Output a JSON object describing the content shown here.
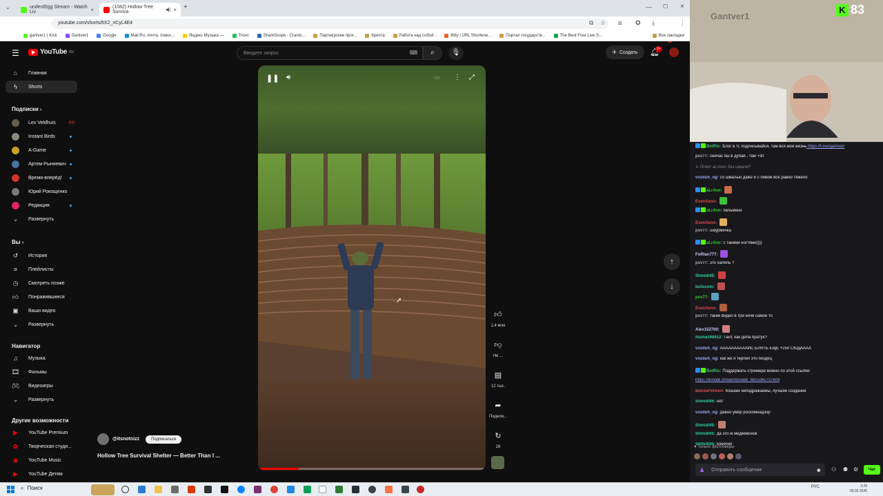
{
  "browser": {
    "tabs": [
      {
        "title": "underd0gg Stream - Watch Liv",
        "color": "#53fc18",
        "active": false
      },
      {
        "title": "(1082) Hollow Tree Surviva",
        "color": "#ff0000",
        "active": true
      }
    ],
    "url": "youtube.com/shorts/6X2_nCyL4E4",
    "bookmarks": [
      "gantver1 | Kick",
      "Gantver1",
      "Google",
      "Mail.Ru: почта, поиск...",
      "Яндекс Музыка —",
      "Trovo",
      "SharkScope - Cranio...",
      "Партнерские прог...",
      "Крипта",
      "Работа над собой -",
      "Bitly | URL Shortene...",
      "Портал государств...",
      "The Best Free Live S...",
      "Все закладки"
    ]
  },
  "youtube": {
    "logo_text": "YouTube",
    "logo_region": "RU",
    "search_placeholder": "Введите запрос",
    "create_label": "Создать",
    "notification_count": "9+",
    "sidebar": {
      "main": [
        {
          "label": "Главная",
          "icon": "home-icon"
        },
        {
          "label": "Shorts",
          "icon": "shorts-icon",
          "active": true
        }
      ],
      "subscriptions_header": "Подписки",
      "subscriptions": [
        {
          "label": "Lex Veldhuis",
          "color": "#6b5b4b",
          "indicator": "live"
        },
        {
          "label": "Instant Birds",
          "color": "#8a8a7a",
          "indicator": "dot"
        },
        {
          "label": "A-Game",
          "color": "#c9a227",
          "indicator": "dot"
        },
        {
          "label": "Артем Рыняевич",
          "color": "#4a6fa5",
          "indicator": "dot"
        },
        {
          "label": "Время-вперёд!",
          "color": "#d0342c",
          "indicator": "dot"
        },
        {
          "label": "Юрий Рокощенко",
          "color": "#7a7a7a",
          "indicator": ""
        },
        {
          "label": "Редакция",
          "color": "#e0245e",
          "indicator": "dot"
        },
        {
          "label": "Развернуть",
          "icon": "chevron-down-icon"
        }
      ],
      "you_header": "Вы",
      "you": [
        {
          "label": "История",
          "icon": "history-icon"
        },
        {
          "label": "Плейлисты",
          "icon": "playlist-icon"
        },
        {
          "label": "Смотреть позже",
          "icon": "clock-icon"
        },
        {
          "label": "Понравившиеся",
          "icon": "thumbs-up-icon"
        },
        {
          "label": "Ваши видео",
          "icon": "video-icon"
        },
        {
          "label": "Развернуть",
          "icon": "chevron-down-icon"
        }
      ],
      "navigator_header": "Навигатор",
      "navigator": [
        {
          "label": "Музыка",
          "icon": "music-icon"
        },
        {
          "label": "Фильмы",
          "icon": "film-icon"
        },
        {
          "label": "Видеоигры",
          "icon": "gamepad-icon"
        },
        {
          "label": "Развернуть",
          "icon": "chevron-down-icon"
        }
      ],
      "other_header": "Другие возможности",
      "other": [
        {
          "label": "YouTube Premium"
        },
        {
          "label": "Творческая студи..."
        },
        {
          "label": "YouTube Music"
        },
        {
          "label": "YouTube Детям"
        }
      ]
    },
    "short": {
      "channel": "@itsnotnizz",
      "subscribe_label": "Подписаться",
      "title": "Hollow Tree Survival Shelter — Better Than I ...",
      "progress": 0.18,
      "actions": [
        {
          "name": "like",
          "icon": "thumbs-up-icon",
          "label": "1,4 млн"
        },
        {
          "name": "dislike",
          "icon": "thumbs-down-icon",
          "label": "Не ..."
        },
        {
          "name": "comments",
          "icon": "comment-icon",
          "label": "12 тыс."
        },
        {
          "name": "share",
          "icon": "share-icon",
          "label": "Подели..."
        },
        {
          "name": "remix",
          "icon": "remix-icon",
          "label": "26"
        }
      ]
    }
  },
  "stream": {
    "viewers": "83",
    "accent": "#53fc18",
    "watermark": "Gantver1",
    "chat": [
      {
        "user": "BotRix",
        "color": "#3ec46d",
        "text": "Блог в тг, подписывайся, там вся моя жизнь",
        "link": "https://t.me/gantverr",
        "badges": true
      },
      {
        "user": "psv77",
        "color": "#b0b0b0",
        "text": "сейчас бы в дубай , там +30"
      },
      {
        "user": "",
        "color": "#888",
        "text": "↳ Ответ aLrAvo: без шмали?",
        "muted": true
      },
      {
        "user": "vozduh_og",
        "color": "#9aa7ff",
        "text": "со шмалью даже и с пивом все равно тяжело"
      },
      {
        "user": "aLrAvo",
        "color": "#2fd02f",
        "text": "",
        "emote": "#c86b4a",
        "badges": true
      },
      {
        "user": "EvenXeno",
        "color": "#e04b4b",
        "text": "",
        "emote": "#3cbf3c"
      },
      {
        "user": "aLrAvo",
        "color": "#2fd02f",
        "text": "пельмени",
        "badges": true
      },
      {
        "user": "EvenXeno",
        "color": "#e04b4b",
        "text": "",
        "emote": "#e0b060"
      },
      {
        "user": "psv77",
        "color": "#b0b0b0",
        "text": "шаурмечка"
      },
      {
        "user": "aLrAvo",
        "color": "#2fd02f",
        "text": "с такими ногтями))))",
        "badges": true
      },
      {
        "user": "FoRlan777",
        "color": "#c9c9ff",
        "text": "",
        "emote": "#a050e0"
      },
      {
        "user": "psv77",
        "color": "#b0b0b0",
        "text": "это халяль ?"
      },
      {
        "user": "Shmidt45",
        "color": "#2fd0a0",
        "text": "",
        "emote": "#d04040"
      },
      {
        "user": "lezlocom",
        "color": "#2fd0a0",
        "text": "",
        "emote": "#c05050"
      },
      {
        "user": "psv77",
        "color": "#2fd02f",
        "text": "",
        "emote": "#5aa0c0"
      },
      {
        "user": "EvenXeno",
        "color": "#e04b4b",
        "text": "",
        "emote": "#b06040"
      },
      {
        "user": "psv77",
        "color": "#b0b0b0",
        "text": "такие видео в три ночи самое то"
      },
      {
        "user": "Alex152700",
        "color": "#c9c9ff",
        "text": "",
        "emote": "#d08080"
      },
      {
        "user": "Ilusha198912",
        "color": "#2fd0a0",
        "text": "Гант, как дела братух?"
      },
      {
        "user": "vozduh_og",
        "color": "#9aa7ff",
        "text": "ААААААААААЙС БЛЯТЬ ЕЩЕ +250 СЮДАААА"
      },
      {
        "user": "vozduh_og",
        "color": "#9aa7ff",
        "text": "как же я терпел это пиздец"
      },
      {
        "user": "BotRix",
        "color": "#3ec46d",
        "text": "Поддержать стримера можно по этой ссылке:",
        "badges": true
      },
      {
        "user": "",
        "color": "#9aa7ff",
        "text": "https://donate.stream/donate_682cd6c7376c9",
        "link_only": true
      },
      {
        "user": "BandaPelmen",
        "color": "#e04b4b",
        "text": "Кошаки неподражаемы, лучшие создания"
      },
      {
        "user": "Shmidt45",
        "color": "#2fd0a0",
        "text": "нет"
      },
      {
        "user": "vozduh_og",
        "color": "#9aa7ff",
        "text": "давно умер роскомнадзор"
      },
      {
        "user": "Shmidt45",
        "color": "#2fd0a0",
        "text": "",
        "emote": "#c08070"
      },
      {
        "user": "Shmidt45",
        "color": "#2fd0a0",
        "text": "да это ж медвежонок"
      },
      {
        "user": "Shmidt45",
        "color": "#2fd0a0",
        "text": "конечно"
      }
    ],
    "followers_only": "Только фолловеры",
    "message_placeholder": "Отправить сообщение",
    "chat_button": "Чат"
  },
  "taskbar": {
    "search_label": "Поиск",
    "lang": "РУС",
    "time": "3:29",
    "date": "09.02.2026"
  }
}
